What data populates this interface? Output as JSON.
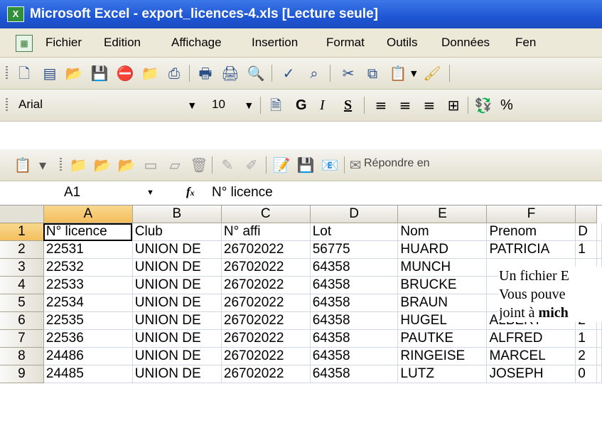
{
  "window": {
    "title": "Microsoft Excel - export_licences-4.xls  [Lecture seule]"
  },
  "menu": [
    "Fichier",
    "Edition",
    "Affichage",
    "Insertion",
    "Format",
    "Outils",
    "Données",
    "Fen"
  ],
  "format_toolbar": {
    "font": "Arial",
    "size": "10",
    "bold": "G",
    "italic": "I",
    "underline": "S",
    "percent": "%"
  },
  "review_toolbar": {
    "reply_label": "Répondre en"
  },
  "formula_bar": {
    "cell_ref": "A1",
    "fx": "fx",
    "content": "N° licence"
  },
  "columns": [
    "A",
    "B",
    "C",
    "D",
    "E",
    "F",
    ""
  ],
  "rows": [
    {
      "num": "1",
      "cells": [
        "N° licence",
        "Club",
        "N° affi",
        "Lot",
        "Nom",
        "Prenom",
        "D"
      ]
    },
    {
      "num": "2",
      "cells": [
        "22531",
        "UNION DE",
        "26702022",
        "56775",
        "HUARD",
        "PATRICIA",
        "1"
      ]
    },
    {
      "num": "3",
      "cells": [
        "22532",
        "UNION DE",
        "26702022",
        "64358",
        "MUNCH",
        "",
        ""
      ]
    },
    {
      "num": "4",
      "cells": [
        "22533",
        "UNION DE",
        "26702022",
        "64358",
        "BRUCKE",
        "",
        ""
      ]
    },
    {
      "num": "5",
      "cells": [
        "22534",
        "UNION DE",
        "26702022",
        "64358",
        "BRAUN",
        "",
        ""
      ]
    },
    {
      "num": "6",
      "cells": [
        "22535",
        "UNION DE",
        "26702022",
        "64358",
        "HUGEL",
        "ALBERT",
        "2"
      ]
    },
    {
      "num": "7",
      "cells": [
        "22536",
        "UNION DE",
        "26702022",
        "64358",
        "PAUTKE",
        "ALFRED",
        "1"
      ]
    },
    {
      "num": "8",
      "cells": [
        "24486",
        "UNION DE",
        "26702022",
        "64358",
        "RINGEISE",
        "MARCEL",
        "2"
      ]
    },
    {
      "num": "9",
      "cells": [
        "24485",
        "UNION DE",
        "26702022",
        "64358",
        "LUTZ",
        "JOSEPH",
        "0"
      ]
    }
  ],
  "overlay": {
    "line1": "Un fichier E",
    "line2": "Vous pouve",
    "line3_prefix": "joint à ",
    "line3_bold": "mich"
  }
}
